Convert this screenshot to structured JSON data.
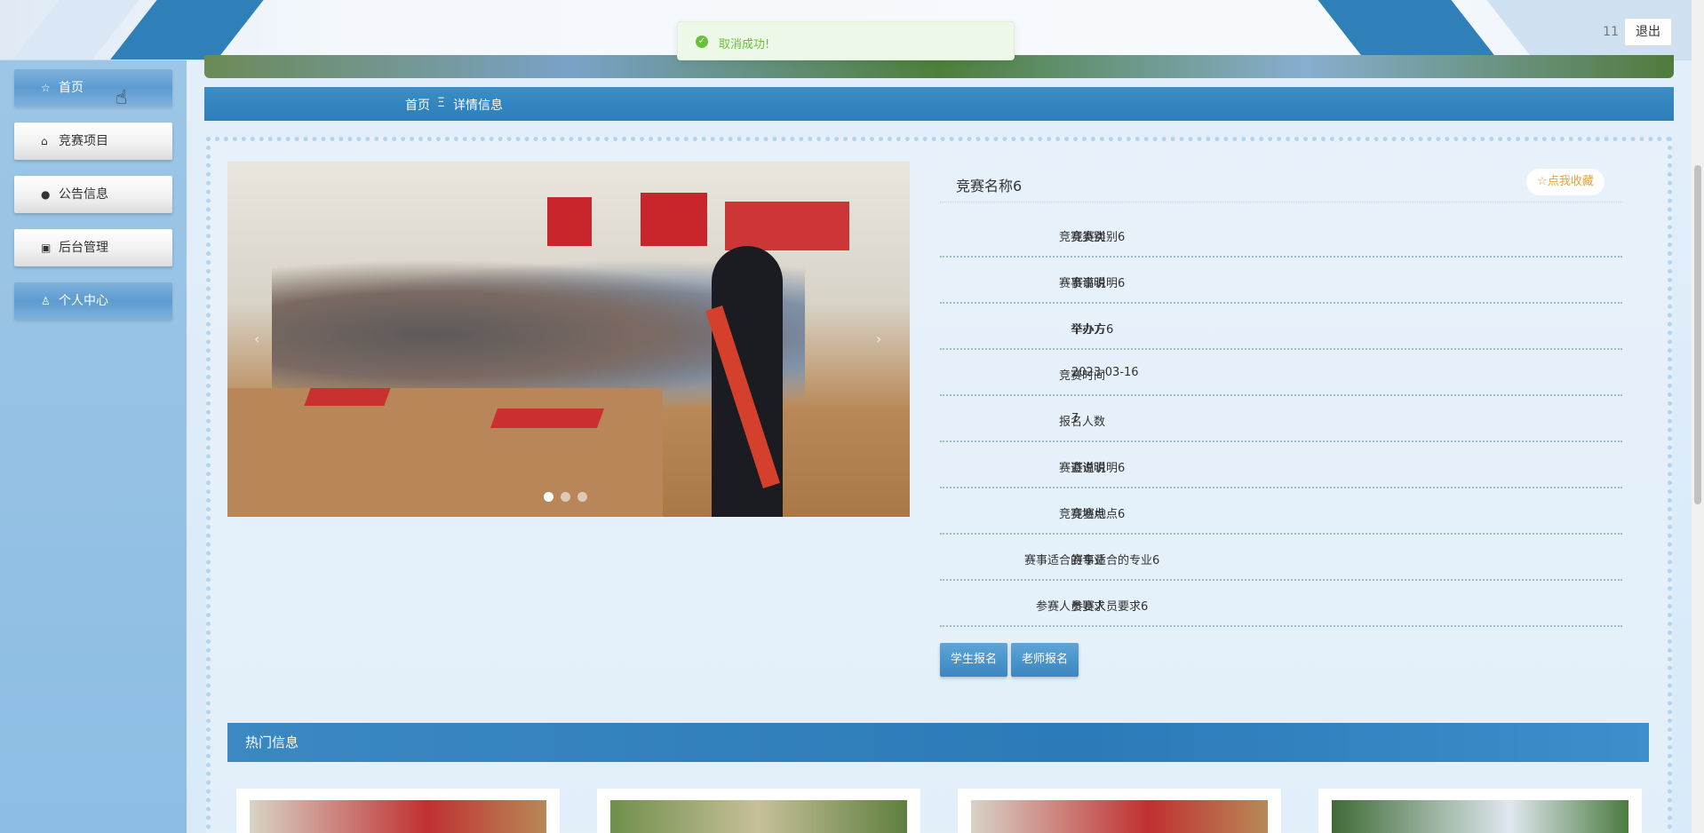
{
  "header": {
    "site_title": "",
    "user_count": "11",
    "logout_label": "退出"
  },
  "toast": {
    "message": "取消成功!",
    "color": "#67c23a"
  },
  "sidebar": {
    "items": [
      {
        "label": "首页",
        "icon": "star-icon",
        "style": "blue"
      },
      {
        "label": "竞赛项目",
        "icon": "bag-icon",
        "style": "white"
      },
      {
        "label": "公告信息",
        "icon": "info-icon",
        "style": "white"
      },
      {
        "label": "后台管理",
        "icon": "briefcase-icon",
        "style": "white"
      },
      {
        "label": "个人中心",
        "icon": "user-icon",
        "style": "blue"
      }
    ]
  },
  "breadcrumb": {
    "home": "首页",
    "separator": "Ξ",
    "current": "详情信息"
  },
  "detail": {
    "title": "竞赛名称6",
    "favorite_label": "点我收藏",
    "fields": [
      {
        "key": "竞赛类别",
        "value": "竞赛类别6"
      },
      {
        "key": "赛事说明",
        "value": "赛事说明6"
      },
      {
        "key": "举办方",
        "value": "举办方6"
      },
      {
        "key": "竞赛时间",
        "value": "2023-03-16"
      },
      {
        "key": "报名人数",
        "value": "7"
      },
      {
        "key": "赛道说明",
        "value": "赛道说明6"
      },
      {
        "key": "竞赛地点",
        "value": "竞赛地点6"
      },
      {
        "key": "赛事适合的专业",
        "value": "赛事适合的专业6"
      },
      {
        "key": "参赛人员要求",
        "value": "参赛人员要求6"
      }
    ],
    "student_signup_label": "学生报名",
    "teacher_signup_label": "老师报名"
  },
  "carousel": {
    "slide_count": 3,
    "active_index": 0
  },
  "hot": {
    "title": "热门信息"
  },
  "colors": {
    "accent": "#2e7db8",
    "sidebar_bg": "#9cc6e6",
    "favorite": "#e6a23c"
  }
}
